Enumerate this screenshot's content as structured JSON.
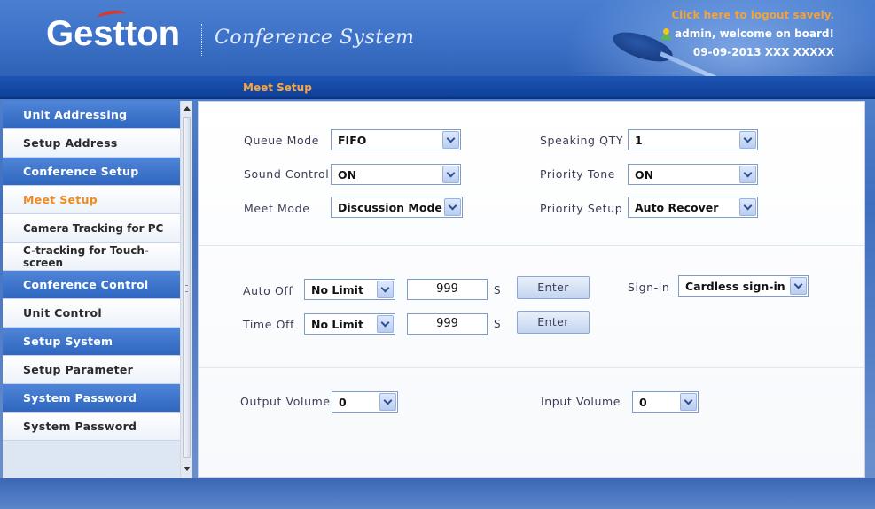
{
  "header": {
    "logo": "Gestton",
    "subtitle": "Conference System",
    "logout_text": "Click here to logout savely.",
    "welcome_text": "admin, welcome on board!",
    "datetime_text": "09-09-2013  XXX  XXXXX"
  },
  "nav": {
    "title": "Meet Setup"
  },
  "sidebar": {
    "items": [
      {
        "label": "Unit Addressing",
        "type": "group"
      },
      {
        "label": "Setup Address",
        "type": "link"
      },
      {
        "label": "Conference Setup",
        "type": "group"
      },
      {
        "label": "Meet Setup",
        "type": "link",
        "active": true
      },
      {
        "label": "Camera Tracking for PC",
        "type": "link"
      },
      {
        "label": "C-tracking for Touch-screen",
        "type": "link"
      },
      {
        "label": "Conference Control",
        "type": "group"
      },
      {
        "label": "Unit Control",
        "type": "link"
      },
      {
        "label": "Setup System",
        "type": "group"
      },
      {
        "label": "Setup Parameter",
        "type": "link"
      },
      {
        "label": "System Password",
        "type": "group"
      },
      {
        "label": "System Password",
        "type": "link"
      }
    ]
  },
  "form": {
    "queue_mode": {
      "label": "Queue Mode",
      "value": "FIFO"
    },
    "sound_control": {
      "label": "Sound Control",
      "value": "ON"
    },
    "meet_mode": {
      "label": "Meet Mode",
      "value": "Discussion Mode"
    },
    "speaking_qty": {
      "label": "Speaking QTY",
      "value": "1"
    },
    "priority_tone": {
      "label": "Priority Tone",
      "value": "ON"
    },
    "priority_setup": {
      "label": "Priority Setup",
      "value": "Auto Recover"
    },
    "auto_off": {
      "label": "Auto Off",
      "select_value": "No Limit",
      "number": "999",
      "unit": "S",
      "button": "Enter"
    },
    "time_off": {
      "label": "Time Off",
      "select_value": "No Limit",
      "number": "999",
      "unit": "S",
      "button": "Enter"
    },
    "sign_in": {
      "label": "Sign-in",
      "value": "Cardless sign-in"
    },
    "output_volume": {
      "label": "Output Volume",
      "value": "0"
    },
    "input_volume": {
      "label": "Input Volume",
      "value": "0"
    }
  },
  "colors": {
    "header_blue": "#3d72c8",
    "nav_blue": "#0e3f98",
    "accent_orange": "#f08a1c",
    "group_blue": "#2f66bf"
  }
}
